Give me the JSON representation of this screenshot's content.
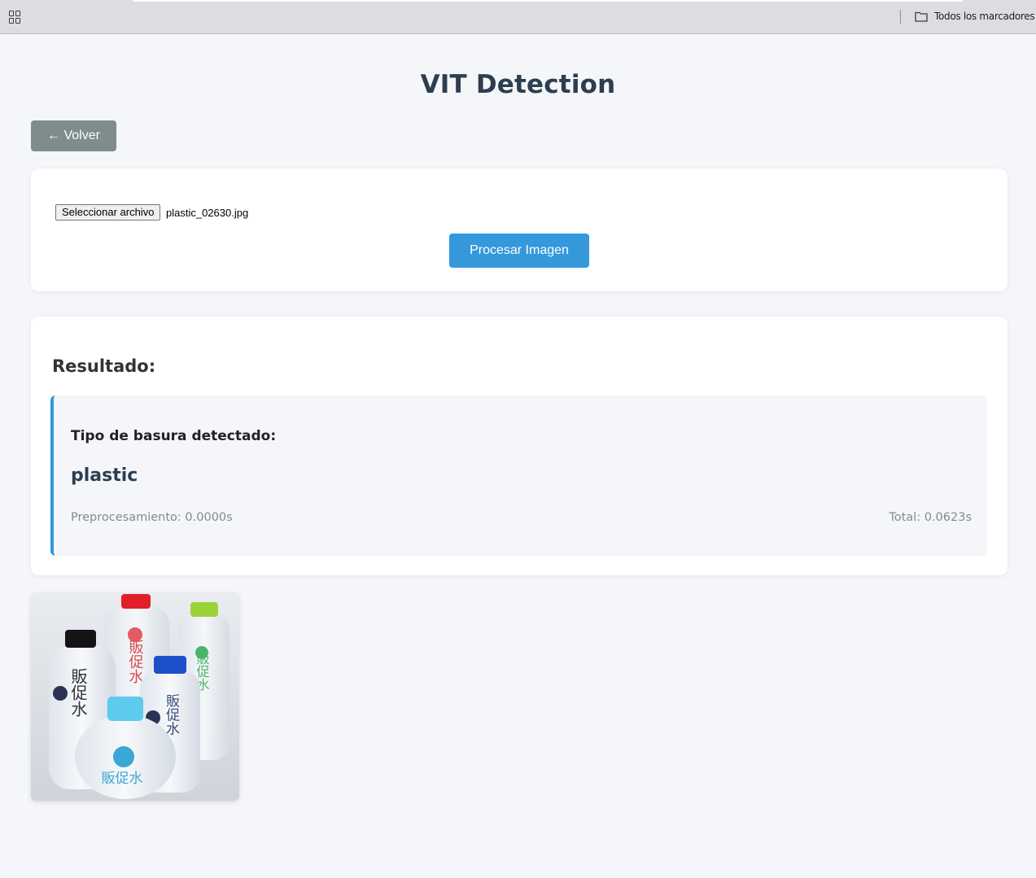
{
  "browser": {
    "apps_icon": "apps-grid-icon",
    "bookmarks_label": "Todos los marcadores",
    "bookmarks_icon": "folder-icon"
  },
  "page": {
    "title": "VIT Detection",
    "back_label": "← Volver"
  },
  "upload": {
    "choose_file_label": "Seleccionar archivo",
    "file_name": "plastic_02630.jpg",
    "process_label": "Procesar Imagen"
  },
  "result": {
    "heading": "Resultado:",
    "type_label": "Tipo de basura detectado:",
    "class_name": "plastic",
    "preprocessing": "Preprocesamiento: 0.0000s",
    "total": "Total: 0.0623s"
  },
  "image": {
    "description": "plastic bottles photo",
    "bottle_text": "販促水"
  },
  "colors": {
    "accent": "#3498db",
    "back_button": "#7f8c8d",
    "title": "#2c3e50"
  }
}
